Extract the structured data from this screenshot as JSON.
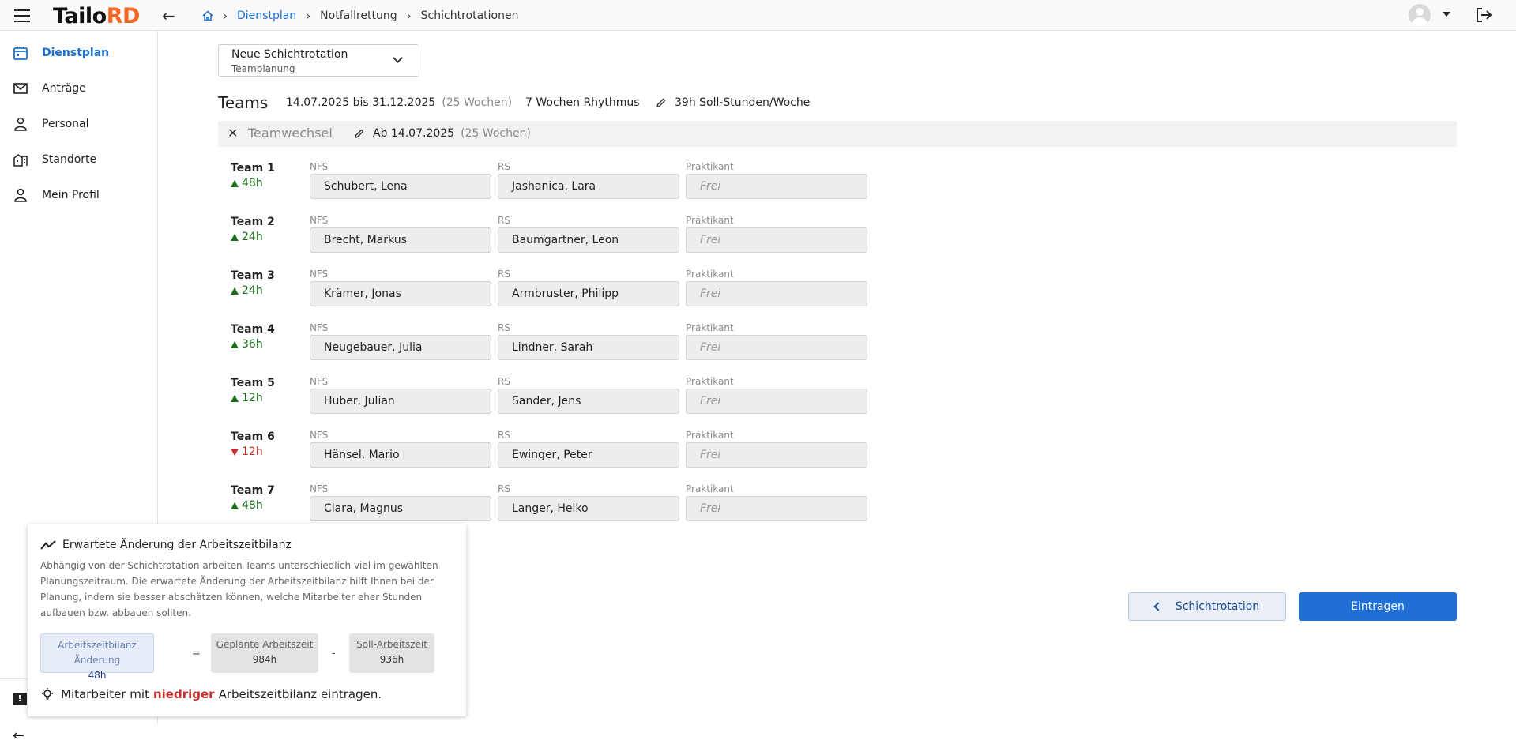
{
  "app": {
    "logo_main": "Tailo",
    "logo_accent": "RD",
    "brand_color": "#f26522",
    "accent_color": "#1a6fd0"
  },
  "breadcrumb": {
    "items": [
      "Dienstplan",
      "Notfallrettung",
      "Schichtrotationen"
    ]
  },
  "sidebar": {
    "items": [
      {
        "label": "Dienstplan",
        "icon": "calendar-icon",
        "active": true
      },
      {
        "label": "Anträge",
        "icon": "mail-icon",
        "active": false
      },
      {
        "label": "Personal",
        "icon": "person-icon",
        "active": false
      },
      {
        "label": "Standorte",
        "icon": "buildings-icon",
        "active": false
      },
      {
        "label": "Mein Profil",
        "icon": "person-icon",
        "active": false
      }
    ]
  },
  "rotation_select": {
    "title": "Neue Schichtrotation",
    "subtitle": "Teamplanung"
  },
  "summary": {
    "title": "Teams",
    "range": "14.07.2025 bis 31.12.2025",
    "weeks": "(25 Wochen)",
    "rhythm": "7 Wochen Rhythmus",
    "soll": "39h Soll-Stunden/Woche"
  },
  "teamchange": {
    "label": "Teamwechsel",
    "from": "Ab 14.07.2025",
    "weeks": "(25 Wochen)"
  },
  "column_labels": {
    "nfs": "NFS",
    "rs": "RS",
    "praktikant": "Praktikant"
  },
  "teams": [
    {
      "name": "Team 1",
      "delta": "48h",
      "direction": "up",
      "nfs": "Schubert, Lena",
      "rs": "Jashanica, Lara",
      "praktikant": "Frei"
    },
    {
      "name": "Team 2",
      "delta": "24h",
      "direction": "up",
      "nfs": "Brecht, Markus",
      "rs": "Baumgartner, Leon",
      "praktikant": "Frei"
    },
    {
      "name": "Team 3",
      "delta": "24h",
      "direction": "up",
      "nfs": "Krämer, Jonas",
      "rs": "Armbruster, Philipp",
      "praktikant": "Frei"
    },
    {
      "name": "Team 4",
      "delta": "36h",
      "direction": "up",
      "nfs": "Neugebauer, Julia",
      "rs": "Lindner, Sarah",
      "praktikant": "Frei"
    },
    {
      "name": "Team 5",
      "delta": "12h",
      "direction": "up",
      "nfs": "Huber, Julian",
      "rs": "Sander, Jens",
      "praktikant": "Frei"
    },
    {
      "name": "Team 6",
      "delta": "12h",
      "direction": "down",
      "nfs": "Hänsel, Mario",
      "rs": "Ewinger, Peter",
      "praktikant": "Frei"
    },
    {
      "name": "Team 7",
      "delta": "48h",
      "direction": "up",
      "nfs": "Clara, Magnus",
      "rs": "Langer, Heiko",
      "praktikant": "Frei"
    }
  ],
  "buttons": {
    "rotation": "Schichtrotation",
    "save": "Eintragen"
  },
  "info": {
    "title": "Erwartete Änderung der Arbeitszeitbilanz",
    "description": "Abhängig von der Schichtrotation arbeiten Teams unterschiedlich viel im gewählten Planungszeitraum. Die erwartete Änderung der Arbeitszeitbilanz hilft Ihnen bei der Planung, indem sie besser abschätzen können, welche Mitarbeiter eher Stunden aufbauen bzw. abbauen sollten.",
    "calc": {
      "result_label": "Arbeitszeitbilanz Änderung",
      "result_value": "48h",
      "eq": "=",
      "planned_label": "Geplante Arbeitszeit",
      "planned_value": "984h",
      "minus": "-",
      "soll_label": "Soll-Arbeitszeit",
      "soll_value": "936h"
    },
    "tip_pre": "Mitarbeiter mit",
    "tip_highlight": "niedriger",
    "tip_post": "Arbeitszeitbilanz eintragen."
  }
}
